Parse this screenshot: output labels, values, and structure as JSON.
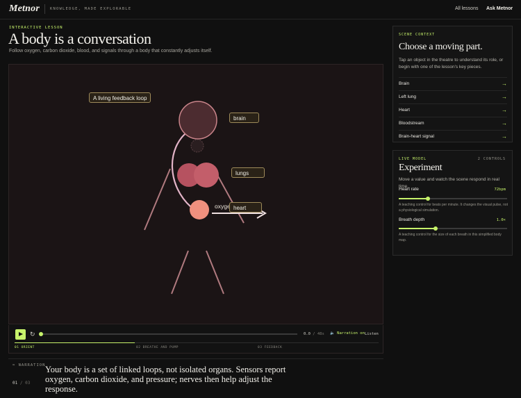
{
  "app": {
    "logo": "Metnor",
    "tagline": "KNOWLEDGE, MADE EXPLORABLE",
    "nav": {
      "all_lessons": "All lessons",
      "ask": "Ask Metnor"
    }
  },
  "lesson": {
    "eyebrow": "INTERACTIVE LESSON",
    "title": "A body is a conversation",
    "subtitle": "Follow oxygen, carbon dioxide, blood, and signals through a body that constantly adjusts itself."
  },
  "stage": {
    "labels": {
      "loop": "A living feedback loop",
      "brain": "brain",
      "lungs": "lungs",
      "heart": "heart",
      "oxygen": "oxygen",
      "oxygen_tail": "s"
    },
    "colors": {
      "accent": "#c7f36b",
      "tag_border": "#9f8b5a",
      "organ": "#c3565e",
      "heart": "#f09080"
    }
  },
  "player": {
    "play_icon": "play-icon",
    "replay_icon": "replay-icon",
    "progress": 0.0,
    "time_current": "0.0",
    "time_sep": "/",
    "time_total": "48s",
    "narration": "Narration on",
    "listen": "Listen",
    "chapters": [
      {
        "num": "01",
        "label": "ORIENT",
        "active": true
      },
      {
        "num": "02",
        "label": "BREATHE AND PUMP",
        "active": false
      },
      {
        "num": "03",
        "label": "FEEDBACK",
        "active": false
      }
    ]
  },
  "narration": {
    "label": "NARRATION",
    "current": "01",
    "sep": "/",
    "total": "03",
    "text": "Your body is a set of linked loops, not isolated organs. Sensors report oxygen, carbon dioxide, and pressure; nerves then help adjust the response."
  },
  "scene_context": {
    "eyebrow": "SCENE CONTEXT",
    "title": "Choose a moving part.",
    "desc": "Tap an object in the theatre to understand its role, or begin with one of the lesson's key pieces.",
    "items": [
      {
        "label": "Brain",
        "arrow": "→"
      },
      {
        "label": "Left lung",
        "arrow": "→"
      },
      {
        "label": "Heart",
        "arrow": "→"
      },
      {
        "label": "Bloodstream",
        "arrow": "→"
      },
      {
        "label": "Brain-heart signal",
        "arrow": "→"
      }
    ]
  },
  "experiment": {
    "eyebrow": "LIVE MODEL",
    "controls_count": "2 CONTROLS",
    "title": "Experiment",
    "desc": "Move a value and watch the scene respond in real time.",
    "heart_rate": {
      "label": "Heart rate",
      "value": "72bpm",
      "level": 0.27,
      "help": "A teaching control for beats per minute. It changes the visual pulse, not a physiological simulation."
    },
    "breath_depth": {
      "label": "Breath depth",
      "value": "1.0×",
      "level": 0.34,
      "help": "A teaching control for the size of each breath in this simplified body map."
    }
  }
}
